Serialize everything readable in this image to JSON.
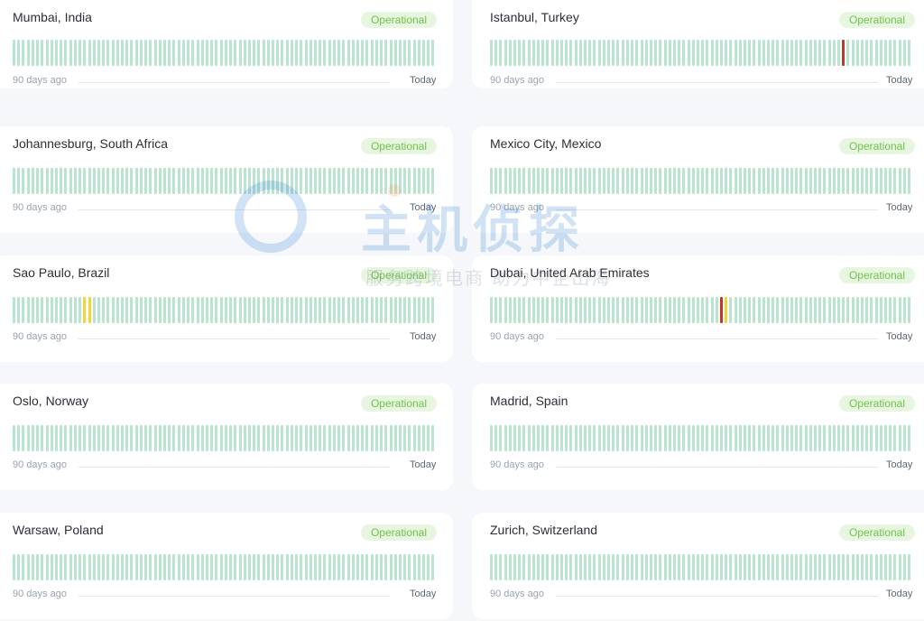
{
  "cards": [
    {
      "name": "Mumbai, India",
      "status": "Operational",
      "from": "90 days ago",
      "to": "Today",
      "incidents": []
    },
    {
      "name": "Istanbul, Turkey",
      "status": "Operational",
      "from": "90 days ago",
      "to": "Today",
      "incidents": [
        {
          "day": 75,
          "level": "down"
        }
      ]
    },
    {
      "name": "Johannesburg, South Africa",
      "status": "Operational",
      "from": "90 days ago",
      "to": "Today",
      "incidents": []
    },
    {
      "name": "Mexico City, Mexico",
      "status": "Operational",
      "from": "90 days ago",
      "to": "Today",
      "incidents": []
    },
    {
      "name": "Sao Paulo, Brazil",
      "status": "Operational",
      "from": "90 days ago",
      "to": "Today",
      "incidents": [
        {
          "day": 15,
          "level": "warn"
        },
        {
          "day": 16,
          "level": "warn"
        }
      ]
    },
    {
      "name": "Dubai, United Arab Emirates",
      "status": "Operational",
      "from": "90 days ago",
      "to": "Today",
      "incidents": [
        {
          "day": 49,
          "level": "down"
        },
        {
          "day": 50,
          "level": "warn"
        }
      ]
    },
    {
      "name": "Oslo, Norway",
      "status": "Operational",
      "from": "90 days ago",
      "to": "Today",
      "incidents": []
    },
    {
      "name": "Madrid, Spain",
      "status": "Operational",
      "from": "90 days ago",
      "to": "Today",
      "incidents": []
    },
    {
      "name": "Warsaw, Poland",
      "status": "Operational",
      "from": "90 days ago",
      "to": "Today",
      "incidents": []
    },
    {
      "name": "Zurich, Switzerland",
      "status": "Operational",
      "from": "90 days ago",
      "to": "Today",
      "incidents": []
    }
  ],
  "days": 90,
  "colors": {
    "ok": "#b9e4cf",
    "warn": "#f2d53b",
    "down": "#c0392b",
    "badge_text": "#6fc34a",
    "badge_bg": "#e8f6e1"
  },
  "watermark": {
    "title": "主机侦探",
    "subtitle": "服务跨境电商 助力中企出海"
  }
}
